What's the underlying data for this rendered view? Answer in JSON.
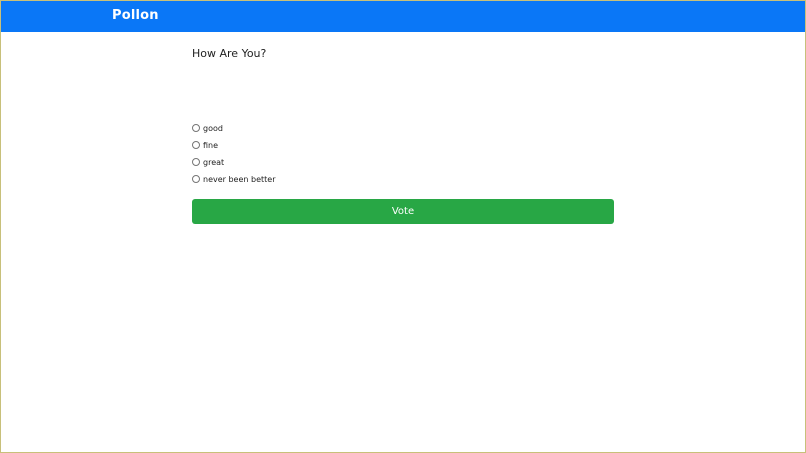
{
  "header": {
    "brand": "Pollon",
    "bg_color": "#0a77f7"
  },
  "poll": {
    "question": "How Are You?",
    "options": [
      {
        "label": "good",
        "selected": false
      },
      {
        "label": "fine",
        "selected": false
      },
      {
        "label": "great",
        "selected": false
      },
      {
        "label": "never been better",
        "selected": false
      }
    ],
    "vote_label": "Vote",
    "vote_color": "#28a745"
  }
}
